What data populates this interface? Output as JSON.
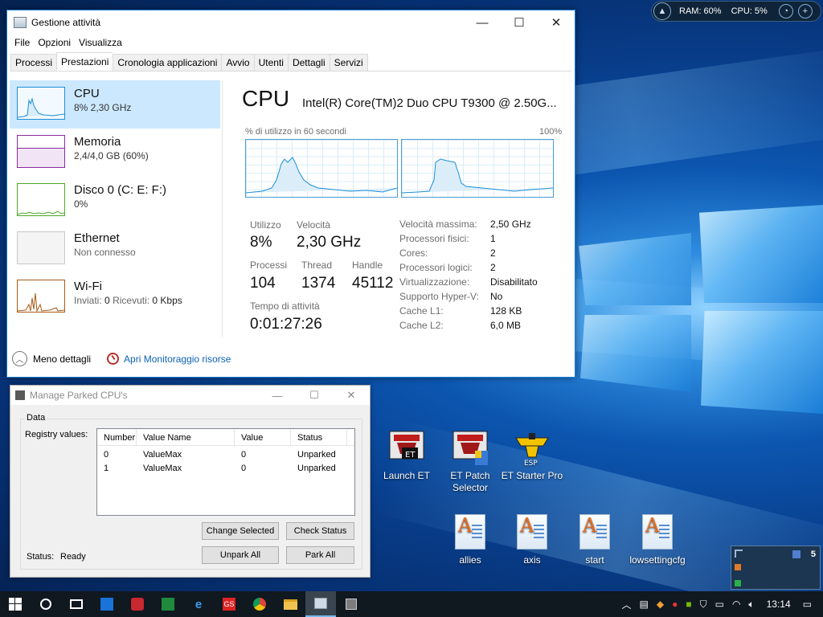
{
  "taskmgr": {
    "title": "Gestione attività",
    "menu": [
      "File",
      "Opzioni",
      "Visualizza"
    ],
    "tabs": [
      "Processi",
      "Prestazioni",
      "Cronologia applicazioni",
      "Avvio",
      "Utenti",
      "Dettagli",
      "Servizi"
    ],
    "sidebar": [
      {
        "name": "CPU",
        "sub": "8%  2,30 GHz",
        "color": "#1c8fd7"
      },
      {
        "name": "Memoria",
        "sub": "2,4/4,0 GB (60%)",
        "color": "#8b2aa0"
      },
      {
        "name": "Disco 0 (C: E: F:)",
        "sub": "0%",
        "color": "#4ea72a"
      },
      {
        "name": "Ethernet",
        "sub": "Non connesso",
        "color": "#b0b0b0"
      },
      {
        "name": "Wi-Fi",
        "sub_sent_label": "Inviati:",
        "sub_sent": "0",
        "sub_recv_label": "Ricevuti:",
        "sub_recv": "0 Kbps",
        "color": "#a95a14"
      }
    ],
    "main": {
      "title": "CPU",
      "cpu_name": "Intel(R) Core(TM)2 Duo CPU T9300 @ 2.50G...",
      "graph_label": "% di utilizzo in 60 secondi",
      "graph_max": "100%",
      "stats": {
        "util_label": "Utilizzo",
        "util": "8%",
        "speed_label": "Velocità",
        "speed": "2,30 GHz",
        "proc_label": "Processi",
        "proc": "104",
        "thread_label": "Thread",
        "thread": "1374",
        "handle_label": "Handle",
        "handle": "45112",
        "uptime_label": "Tempo di attività",
        "uptime": "0:01:27:26"
      },
      "props": [
        {
          "k": "Velocità massima:",
          "v": "2,50 GHz"
        },
        {
          "k": "Processori fisici:",
          "v": "1"
        },
        {
          "k": "Cores:",
          "v": "2"
        },
        {
          "k": "Processori logici:",
          "v": "2"
        },
        {
          "k": "Virtualizzazione:",
          "v": "Disabilitato"
        },
        {
          "k": "Supporto Hyper-V:",
          "v": "No"
        },
        {
          "k": "Cache L1:",
          "v": "128 KB"
        },
        {
          "k": "Cache L2:",
          "v": "6,0 MB"
        }
      ]
    },
    "footer": {
      "less": "Meno dettagli",
      "monitor": "Apri Monitoraggio risorse"
    }
  },
  "parked": {
    "title": "Manage Parked CPU's",
    "group": "Data",
    "registry_label": "Registry values:",
    "columns": [
      "Number",
      "Value Name",
      "Value",
      "Status"
    ],
    "rows": [
      [
        "0",
        "ValueMax",
        "0",
        "Unparked"
      ],
      [
        "1",
        "ValueMax",
        "0",
        "Unparked"
      ]
    ],
    "btn_change": "Change Selected",
    "btn_check": "Check Status",
    "btn_unpark": "Unpark All",
    "btn_park": "Park All",
    "status_label": "Status:",
    "status": "Ready"
  },
  "desktop": {
    "icons": [
      "Launch ET",
      "ET Patch Selector",
      "ET Starter Pro",
      "allies",
      "axis",
      "start",
      "lowsettingcfg"
    ]
  },
  "widget": {
    "ram": "RAM: 60%",
    "cpu": "CPU: 5%"
  },
  "vdesk": {
    "count": "5"
  },
  "taskbar": {
    "time": "13:14",
    "apps": [
      "start-icon",
      "cortana-icon",
      "task-view-icon",
      "file-icon",
      "media-icon",
      "game-icon",
      "edge-icon",
      "gs-icon",
      "chrome-icon",
      "explorer-icon",
      "taskmgr-icon",
      "parked-icon"
    ]
  }
}
